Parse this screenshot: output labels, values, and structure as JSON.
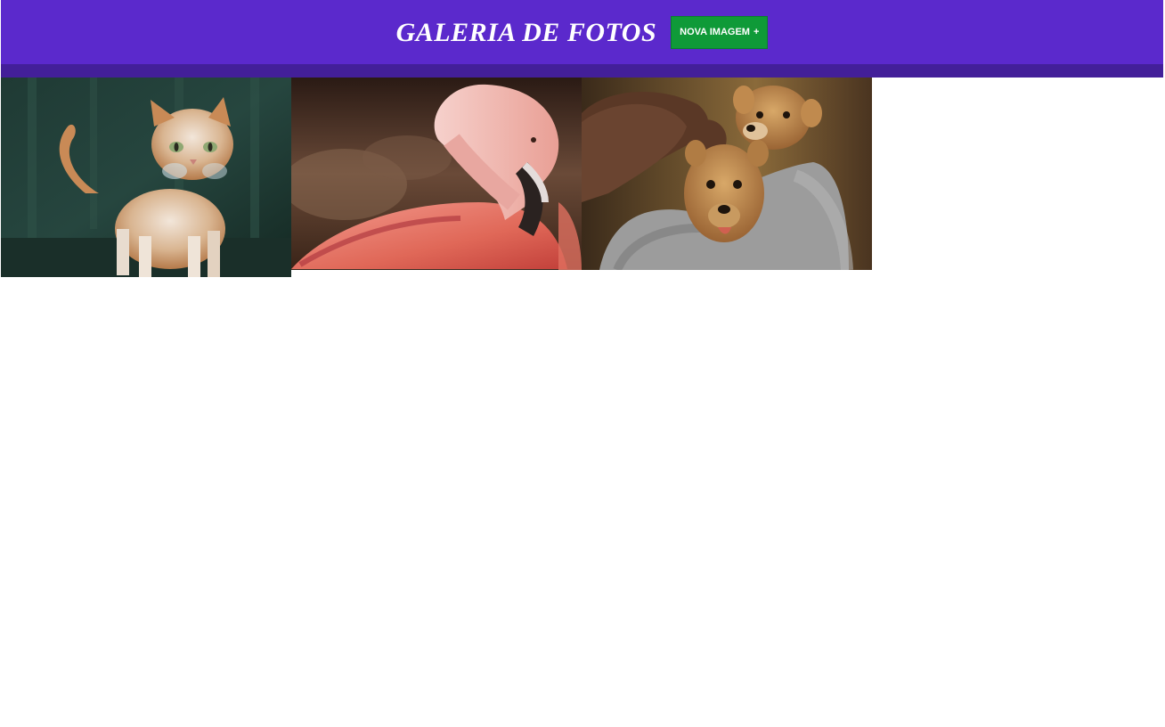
{
  "header": {
    "title": "GALERIA DE FOTOS",
    "new_image_label": "NOVA IMAGEM",
    "new_image_icon": "plus-icon",
    "background_color": "#5b29cc",
    "bar_color": "#431f99",
    "button_color": "#0f9a38"
  },
  "gallery": {
    "photos": [
      {
        "subject": "cat"
      },
      {
        "subject": "flamingo"
      },
      {
        "subject": "puppies"
      }
    ]
  }
}
